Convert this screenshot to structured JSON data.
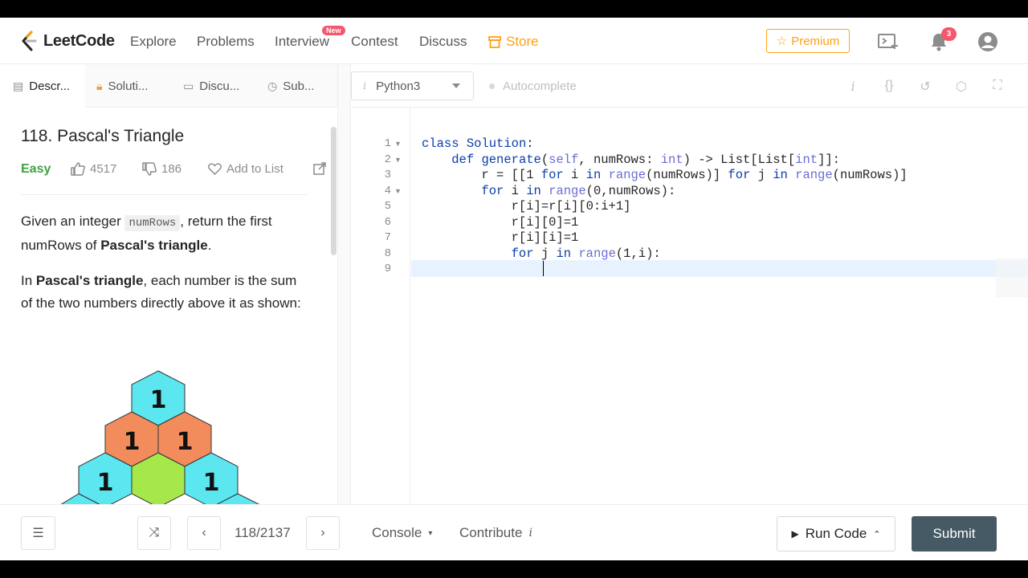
{
  "nav": {
    "brand": "LeetCode",
    "items": [
      "Explore",
      "Problems",
      "Interview",
      "Contest",
      "Discuss"
    ],
    "new_badge": "New",
    "store": "Store",
    "premium": "Premium",
    "notification_count": "3",
    "accent_color": "#ffa116"
  },
  "left_tabs": [
    {
      "label": "Descr...",
      "icon": "description-icon"
    },
    {
      "label": "Soluti...",
      "icon": "lock-icon"
    },
    {
      "label": "Discu...",
      "icon": "comment-icon"
    },
    {
      "label": "Sub...",
      "icon": "clock-icon"
    }
  ],
  "problem": {
    "title": "118. Pascal's Triangle",
    "difficulty": "Easy",
    "likes": "4517",
    "dislikes": "186",
    "add_to_list": "Add to List",
    "desc1_a": "Given an integer ",
    "desc1_code": "numRows",
    "desc1_b": ", return the first numRows of ",
    "desc1_bold": "Pascal's triangle",
    "desc1_c": ".",
    "desc2_a": "In ",
    "desc2_bold": "Pascal's triangle",
    "desc2_b": ", each number is the sum of the two numbers directly above it as shown:",
    "hex_values": [
      "1",
      "1",
      "1",
      "1",
      "1"
    ]
  },
  "editor": {
    "language": "Python3",
    "lang_info": "i",
    "autocomplete": "Autocomplete",
    "line_numbers": [
      "1",
      "2",
      "3",
      "4",
      "5",
      "6",
      "7",
      "8",
      "9"
    ],
    "lines": [
      "class Solution:",
      "    def generate(self, numRows: int) -> List[List[int]]:",
      "        r = [[1 for i in range(numRows)] for j in range(numRows)]",
      "        for i in range(0,numRows):",
      "            r[i]=r[i][0:i+1]",
      "            r[i][0]=1",
      "            r[i][i]=1",
      "            for j in range(1,i):",
      ""
    ],
    "toolbar_info": "i",
    "toolbar_braces": "{}"
  },
  "bottom": {
    "pager": "118/2137",
    "console": "Console",
    "contribute": "Contribute",
    "contribute_info": "i",
    "run": "Run Code",
    "submit": "Submit"
  }
}
